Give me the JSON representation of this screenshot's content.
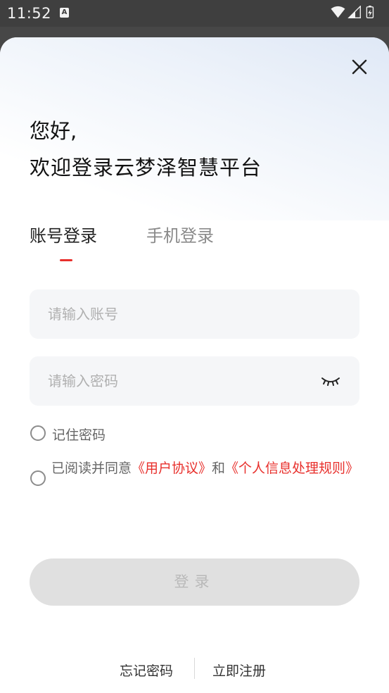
{
  "status_bar": {
    "time": "11:52",
    "notification_letter": "A",
    "icons": [
      "wifi-icon",
      "signal-icon",
      "battery-icon"
    ]
  },
  "sheet": {
    "greeting_line1": "您好,",
    "greeting_line2": "欢迎登录云梦泽智慧平台",
    "tabs": [
      {
        "label": "账号登录",
        "active": true
      },
      {
        "label": "手机登录",
        "active": false
      }
    ],
    "account_field": {
      "placeholder": "请输入账号",
      "value": ""
    },
    "password_field": {
      "placeholder": "请输入密码",
      "value": ""
    },
    "remember": {
      "label": "记住密码",
      "checked": false
    },
    "agreement": {
      "prefix": "已阅读并同意",
      "user_agreement": "《用户协议》",
      "connector": "和",
      "privacy_rules": "《个人信息处理规则》",
      "checked": false
    },
    "login_button": "登录",
    "forgot_password": "忘记密码",
    "register": "立即注册"
  },
  "colors": {
    "accent": "#e8302c",
    "button_disabled_bg": "#e0e0e0",
    "field_bg": "#f5f6f8"
  }
}
